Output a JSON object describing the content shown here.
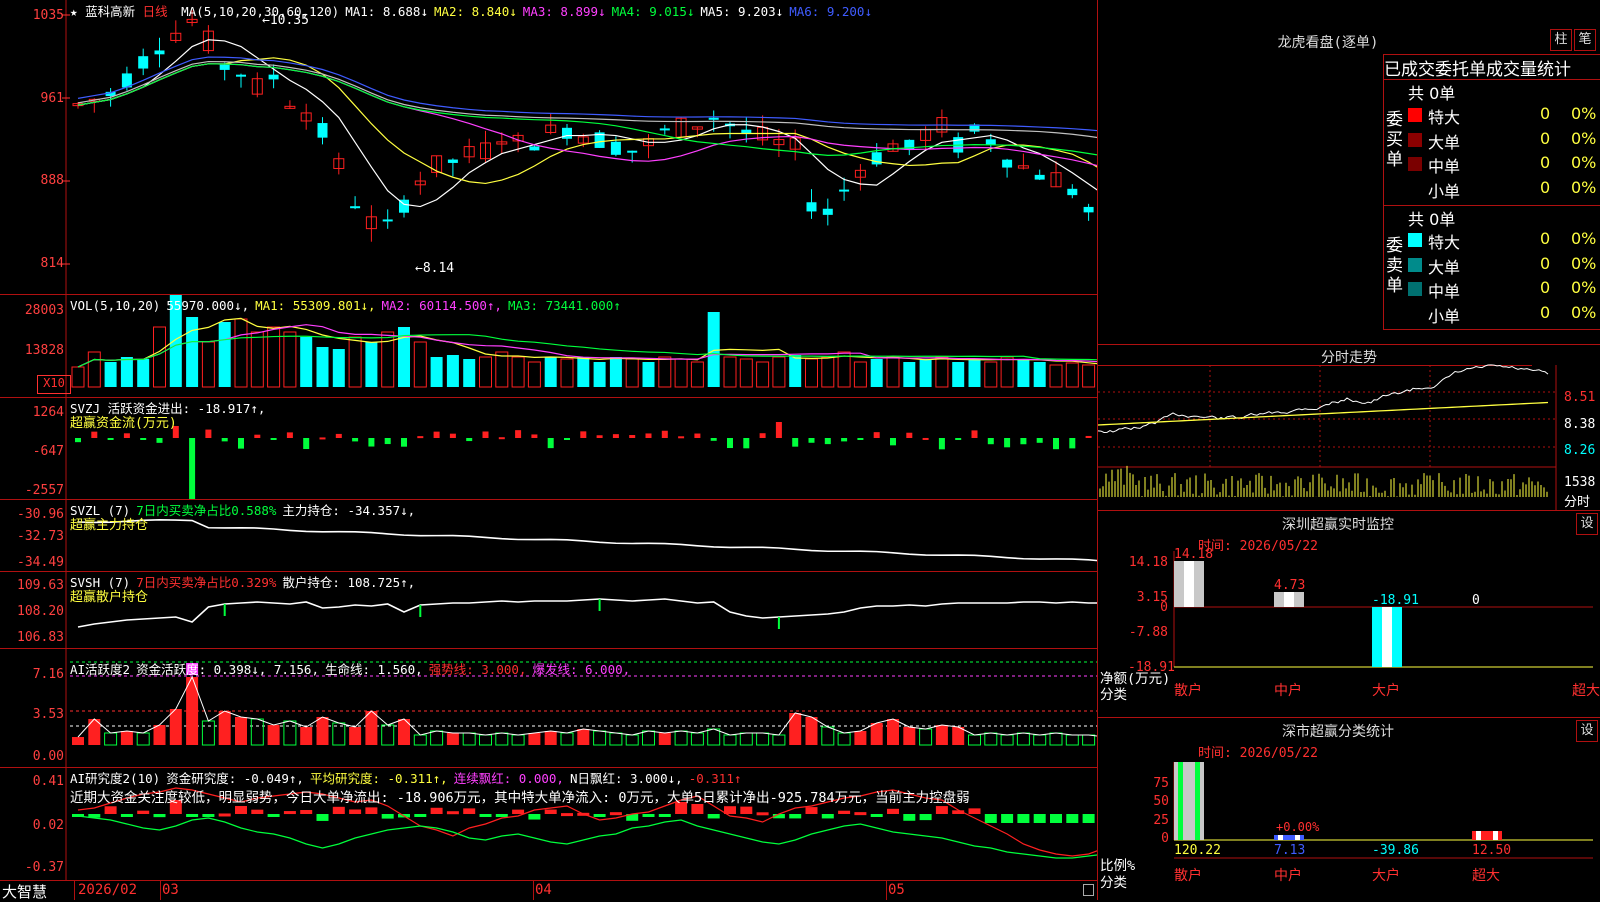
{
  "stock": {
    "star": "★",
    "name": "蓝科高新",
    "period": "日线"
  },
  "kline_header": [
    {
      "t": "MA(5,10,20,30,60,120)",
      "c": "wht"
    },
    {
      "t": "MA1: 8.688↓",
      "c": "wht"
    },
    {
      "t": "MA2: 8.840↓",
      "c": "yel"
    },
    {
      "t": "MA3: 8.899↓",
      "c": "mag"
    },
    {
      "t": "MA4: 9.015↓",
      "c": "grn"
    },
    {
      "t": "MA5: 9.203↓",
      "c": "wht"
    },
    {
      "t": "MA6: 9.200↓",
      "c": "blu"
    }
  ],
  "kline_axis": [
    "1035",
    "961",
    "888",
    "814"
  ],
  "kline_high_note": "10.35",
  "kline_low_note": "8.14",
  "vol_header": [
    {
      "t": "VOL(5,10,20)",
      "c": "wht"
    },
    {
      "t": "55970.000↓,",
      "c": "wht"
    },
    {
      "t": "MA1: 55309.801↓,",
      "c": "yel"
    },
    {
      "t": "MA2: 60114.500↑,",
      "c": "mag"
    },
    {
      "t": "MA3: 73441.000↑",
      "c": "grn"
    }
  ],
  "vol_axis": [
    "28003",
    "13828",
    "X10"
  ],
  "svzj_header": [
    {
      "t": "SVZJ  活跃资金进出: -18.917↑,",
      "c": "wht"
    }
  ],
  "svzj_sub": "超赢资金流(万元)",
  "svzj_axis": [
    "1264",
    "-647",
    "-2557"
  ],
  "svzl_header": [
    {
      "t": "SVZL (7)",
      "c": "wht"
    },
    {
      "t": "7日内买卖净占比0.588%",
      "c": "grn"
    },
    {
      "t": "主力持仓: -34.357↓,",
      "c": "wht"
    }
  ],
  "svzl_sub": "超赢主力持仓",
  "svzl_axis": [
    "-30.96",
    "-32.73",
    "-34.49"
  ],
  "svsh_header": [
    {
      "t": "SVSH (7)",
      "c": "wht"
    },
    {
      "t": "7日内买卖净占比0.329%",
      "c": "red"
    },
    {
      "t": "散户持仓: 108.725↑,",
      "c": "wht"
    }
  ],
  "svsh_sub": "超赢散户持仓",
  "svsh_axis": [
    "109.63",
    "108.20",
    "106.83"
  ],
  "ai1_header": [
    {
      "t": "AI活跃度2",
      "c": "wht"
    },
    {
      "t": "资金活跃度: 0.398↓, 7.156,",
      "c": "wht"
    },
    {
      "t": "生命线: 1.560,",
      "c": "wht"
    },
    {
      "t": "强势线: 3.000,",
      "c": "red"
    },
    {
      "t": "爆发线: 6.000,",
      "c": "mag"
    }
  ],
  "ai1_axis": [
    "7.16",
    "3.53",
    "0.00"
  ],
  "ai2_header": [
    {
      "t": "AI研究度2(10)",
      "c": "wht"
    },
    {
      "t": "资金研究度: -0.049↑,",
      "c": "wht"
    },
    {
      "t": "平均研究度: -0.311↑,",
      "c": "yel"
    },
    {
      "t": "连续飘红: 0.000,",
      "c": "mag"
    },
    {
      "t": "N日飘红: 3.000↓,",
      "c": "wht"
    },
    {
      "t": "-0.311↑",
      "c": "red"
    }
  ],
  "ai2_text": "近期大资金关注度较低，明显弱势，今日大单净流出: -18.906万元，其中特大单净流入: 0万元，大单5日累计净出-925.784万元，当前主力控盘弱",
  "ai2_axis": [
    "0.41",
    "0.02",
    "-0.37"
  ],
  "xaxis": {
    "brand": "大智慧",
    "labels": [
      "2026/02",
      "03",
      "04",
      "05"
    ]
  },
  "lhb": {
    "title": "龙虎看盘(逐单)",
    "btn1": "柱",
    "btn2": "笔",
    "tabs": "已成交委托单成交量统计",
    "buy_label": "委买单",
    "buy_total": "共 0单",
    "sell_label": "委卖单",
    "sell_total": "共 0单",
    "buy_rows": [
      {
        "name": "特大",
        "n": "0",
        "p": "0%",
        "color": "#ff0000"
      },
      {
        "name": "大单",
        "n": "0",
        "p": "0%",
        "color": "#8b0000"
      },
      {
        "name": "中单",
        "n": "0",
        "p": "0%",
        "color": "#7a0000"
      },
      {
        "name": "小单",
        "n": "0",
        "p": "0%",
        "color": ""
      }
    ],
    "sell_rows": [
      {
        "name": "特大",
        "n": "0",
        "p": "0%",
        "color": "#00ffff"
      },
      {
        "name": "大单",
        "n": "0",
        "p": "0%",
        "color": "#008b8b"
      },
      {
        "name": "中单",
        "n": "0",
        "p": "0%",
        "color": "#007070"
      },
      {
        "name": "小单",
        "n": "0",
        "p": "0%",
        "color": ""
      }
    ]
  },
  "fenshi": {
    "title": "分时走势",
    "axis": [
      "8.51",
      "8.38",
      "8.26"
    ],
    "vol": "1538",
    "unit": "分时"
  },
  "sz_monitor": {
    "title": "深圳超赢实时监控",
    "btn": "设",
    "time": "时间: 2026/05/22",
    "axis": [
      "14.18",
      "3.15",
      "0",
      "-7.88",
      "-18.91"
    ],
    "ylabel": "净额(万元)",
    "xlabel": "分类",
    "bars": [
      {
        "label": "散户",
        "value": "14.18"
      },
      {
        "label": "中户",
        "value": "4.73"
      },
      {
        "label": "大户",
        "value": "-18.91"
      },
      {
        "label": "超大",
        "value": "0"
      }
    ]
  },
  "sz_class": {
    "title": "深市超赢分类统计",
    "btn": "设",
    "time": "时间: 2026/05/22",
    "axis": [
      "75",
      "50",
      "25",
      "0"
    ],
    "ylabel": "比例%",
    "xlabel": "分类",
    "bars": [
      {
        "label": "散户",
        "value": "120.22"
      },
      {
        "label": "中户",
        "value": "7.13"
      },
      {
        "label": "大户",
        "value": "-39.86"
      },
      {
        "label": "超大",
        "value": "12.50"
      }
    ],
    "note": "+0.00%"
  }
}
